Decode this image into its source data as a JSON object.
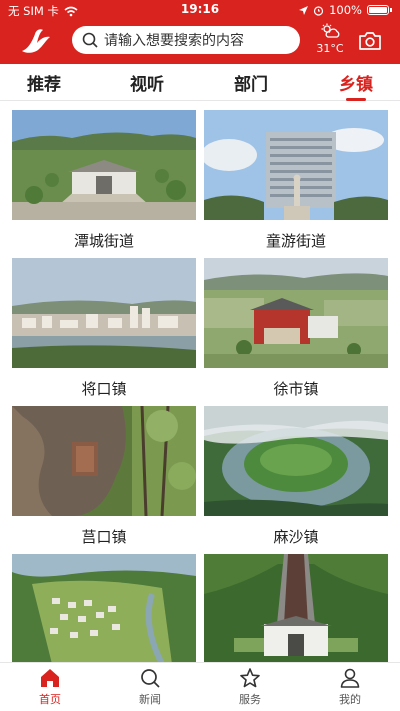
{
  "status": {
    "carrier": "无 SIM 卡",
    "time": "19:16",
    "battery": "100%"
  },
  "header": {
    "search_placeholder": "请输入想要搜索的内容",
    "temperature": "31°C"
  },
  "tabs": [
    {
      "label": "推荐",
      "active": false
    },
    {
      "label": "视听",
      "active": false
    },
    {
      "label": "部门",
      "active": false
    },
    {
      "label": "乡镇",
      "active": true
    }
  ],
  "towns": [
    {
      "name": "潭城街道"
    },
    {
      "name": "童游街道"
    },
    {
      "name": "将口镇"
    },
    {
      "name": "徐市镇"
    },
    {
      "name": "莒口镇"
    },
    {
      "name": "麻沙镇"
    },
    {
      "name": ""
    },
    {
      "name": ""
    }
  ],
  "bottom_nav": [
    {
      "label": "首页",
      "icon": "home-icon",
      "active": true
    },
    {
      "label": "新闻",
      "icon": "search-icon",
      "active": false
    },
    {
      "label": "服务",
      "icon": "star-icon",
      "active": false
    },
    {
      "label": "我的",
      "icon": "user-icon",
      "active": false
    }
  ],
  "colors": {
    "brand": "#d8231f"
  }
}
